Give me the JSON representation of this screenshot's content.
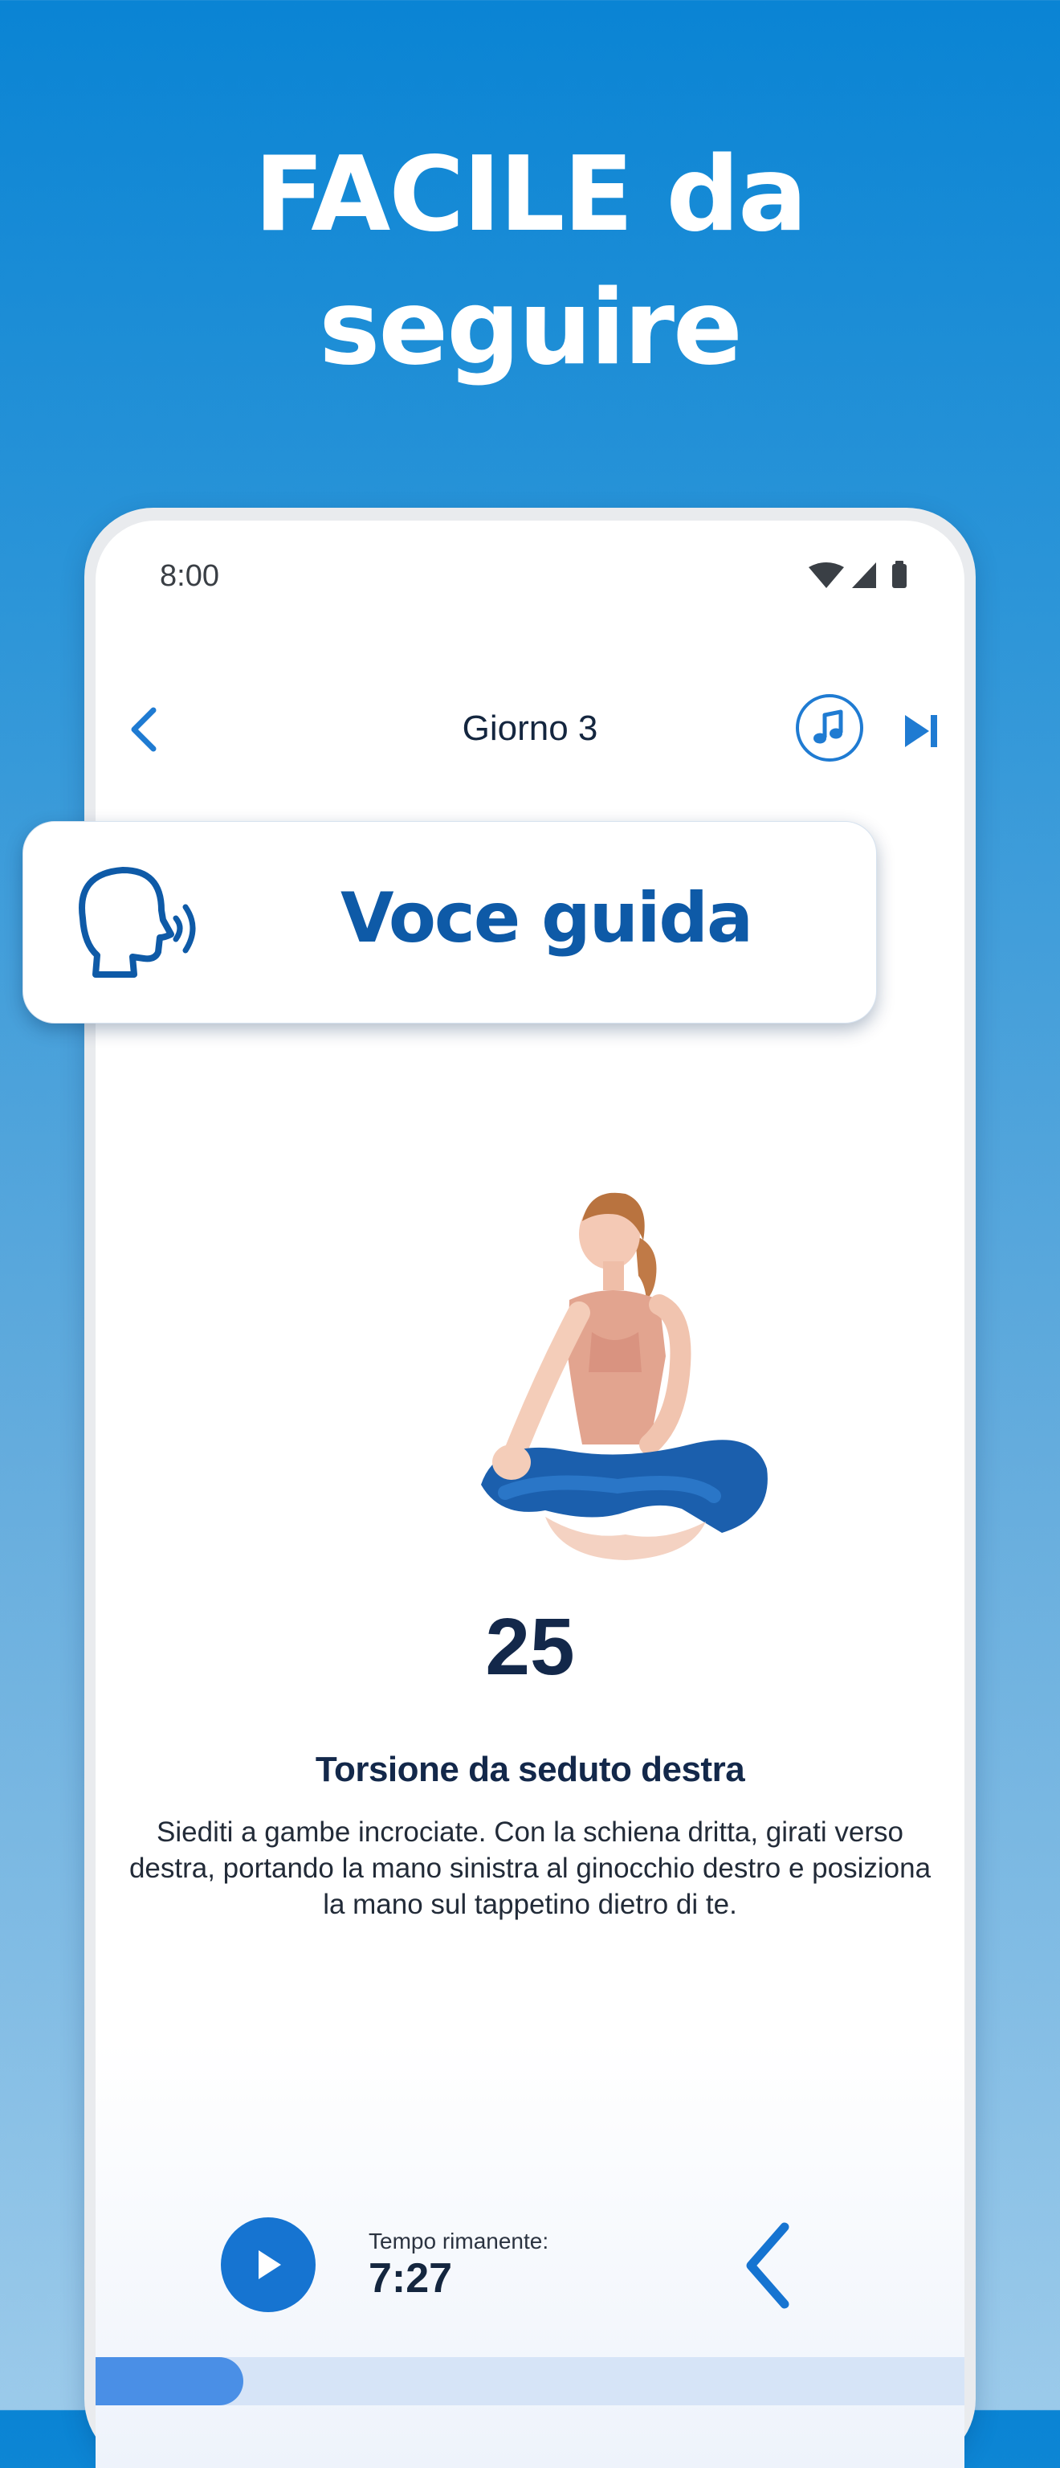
{
  "headline": {
    "line1": "FACILE da",
    "line2": "seguire"
  },
  "status_bar": {
    "time": "8:00",
    "icons": [
      "wifi-icon",
      "signal-icon",
      "battery-icon"
    ]
  },
  "nav": {
    "title": "Giorno 3",
    "back_icon": "chevron-left-icon",
    "music_icon": "music-note-icon",
    "skip_icon": "skip-next-icon"
  },
  "voice_guide": {
    "label": "Voce guida",
    "icon": "speaking-head-icon"
  },
  "exercise": {
    "count": "25",
    "title": "Torsione da seduto destra",
    "description": "Siediti a gambe incrociate. Con la schiena dritta, girati verso destra, portando la mano sinistra al ginocchio destro e posiziona la mano sul tappetino dietro di te."
  },
  "controls": {
    "remaining_label": "Tempo rimanente:",
    "remaining_time": "7:27",
    "play_icon": "play-icon",
    "prev_icon": "chevron-left-icon",
    "next_icon": "chevron-right-icon"
  },
  "progress": {
    "fraction": 0.17
  },
  "colors": {
    "accent": "#1674d1",
    "brand_text": "#0e5aa7",
    "dark_text": "#13284a",
    "progress_fill": "#4a8fe6",
    "progress_track": "#d6e4f7"
  }
}
